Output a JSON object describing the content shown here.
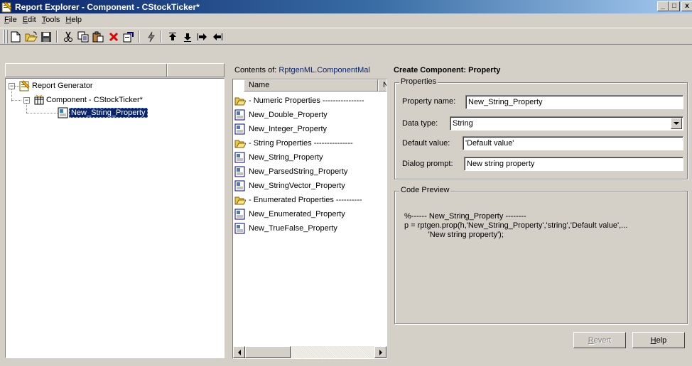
{
  "window": {
    "title": "Report Explorer - Component - CStockTicker*",
    "minimize_glyph": "_",
    "maximize_glyph": "□",
    "close_glyph": "x"
  },
  "menu": [
    "File",
    "Edit",
    "Tools",
    "Help"
  ],
  "toolbar": {
    "icons": [
      "new-icon",
      "open-icon",
      "save-icon",
      "cut-icon",
      "copy-icon",
      "paste-icon",
      "delete-icon",
      "report-icon",
      "run-icon",
      "move-up-icon",
      "move-down-icon",
      "move-right-icon",
      "move-left-icon"
    ]
  },
  "tree": {
    "root": "Report Generator",
    "component": "Component - CStockTicker*",
    "selected": "New_String_Property"
  },
  "contents": {
    "label": "Contents of:",
    "path": "RptgenML.ComponentMal",
    "columns": [
      "Name",
      "N"
    ],
    "items": [
      {
        "label": "- Numeric Properties ----------------",
        "icon": "folder-icon"
      },
      {
        "label": "New_Double_Property",
        "icon": "property-icon"
      },
      {
        "label": "New_Integer_Property",
        "icon": "property-icon"
      },
      {
        "label": "- String Properties ---------------",
        "icon": "folder-icon"
      },
      {
        "label": "New_String_Property",
        "icon": "property-icon"
      },
      {
        "label": "New_ParsedString_Property",
        "icon": "property-icon"
      },
      {
        "label": "New_StringVector_Property",
        "icon": "property-icon"
      },
      {
        "label": "- Enumerated Properties ----------",
        "icon": "folder-icon"
      },
      {
        "label": "New_Enumerated_Property",
        "icon": "property-icon"
      },
      {
        "label": "New_TrueFalse_Property",
        "icon": "property-icon"
      }
    ]
  },
  "detail": {
    "title": "Create Component: Property",
    "properties_group": "Properties",
    "property_name_label": "Property name:",
    "property_name_value": "New_String_Property",
    "data_type_label": "Data type:",
    "data_type_value": "String",
    "default_value_label": "Default value:",
    "default_value_value": "'Default value'",
    "dialog_prompt_label": "Dialog prompt:",
    "dialog_prompt_value": "New string property",
    "code_group": "Code Preview",
    "code_lines": [
      "%------ New_String_Property --------",
      "p = rptgen.prop(h,'New_String_Property','string','Default value',...",
      "           'New string property');"
    ],
    "revert_label": "Revert",
    "help_label": "Help"
  }
}
